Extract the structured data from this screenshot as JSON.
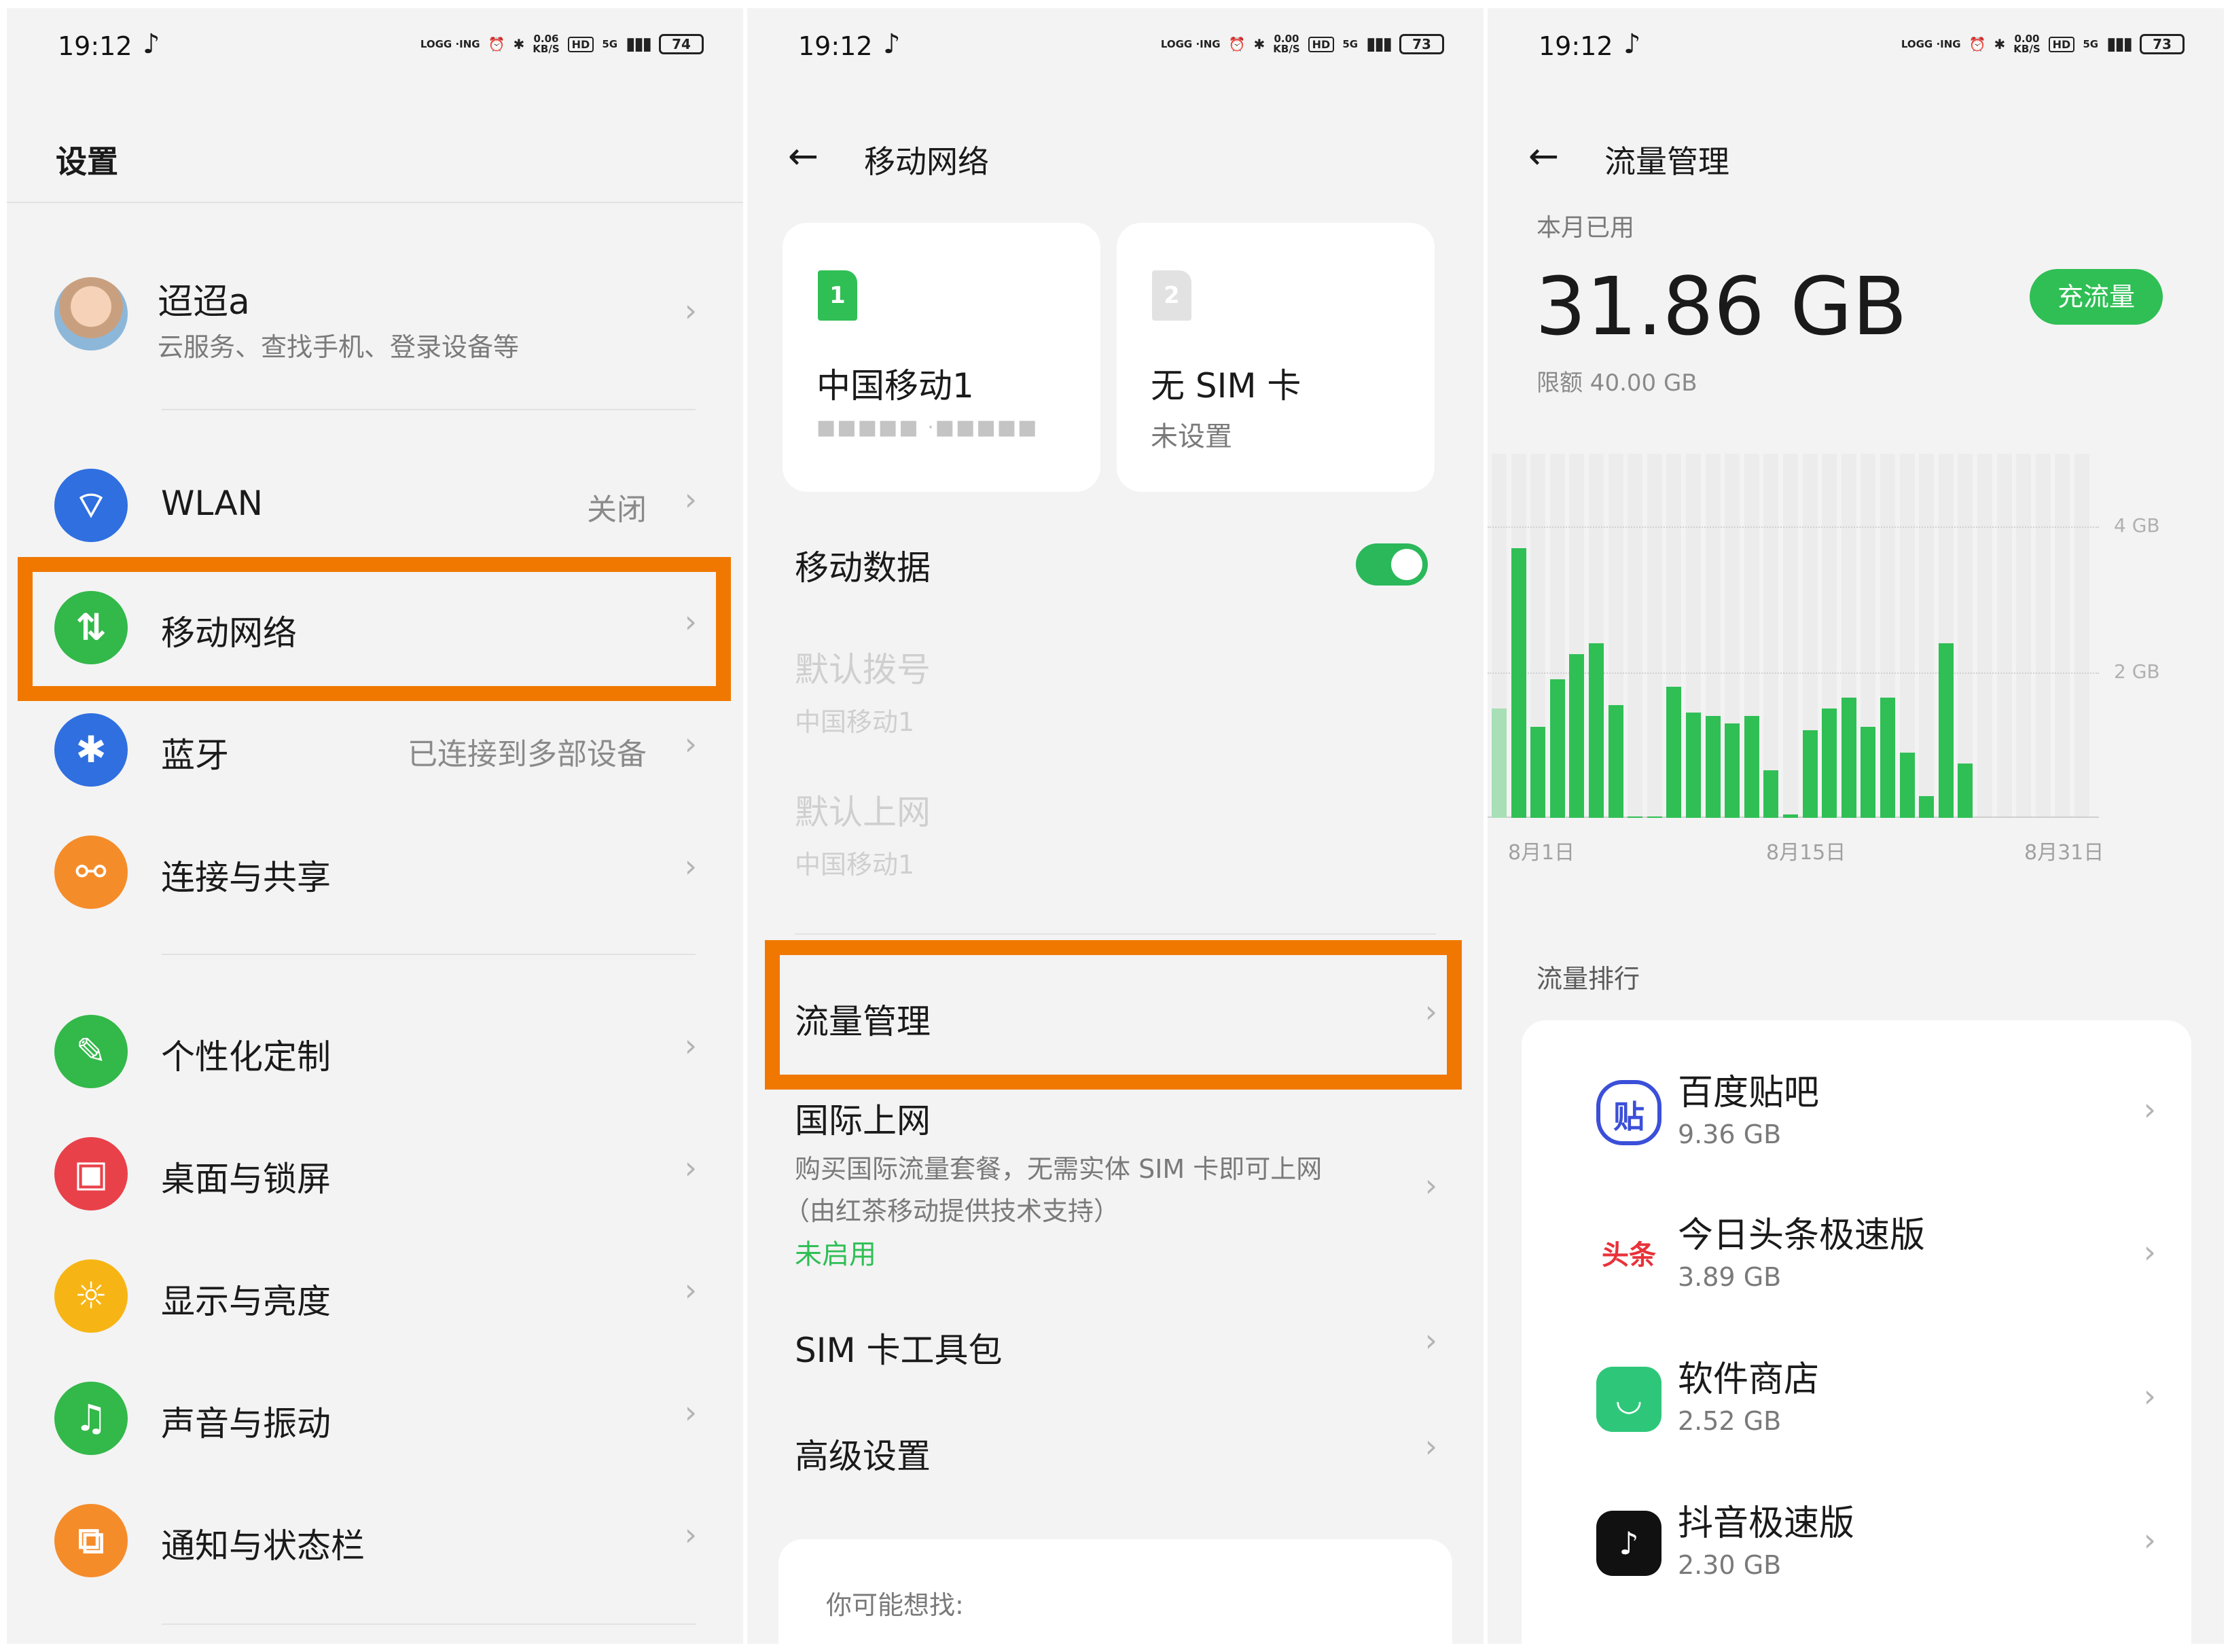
{
  "status": {
    "time": "19:12",
    "net": "LOGG ·ING",
    "speed1": {
      "value": "0.06",
      "unit": "KB/S"
    },
    "speed2": {
      "value": "0.00",
      "unit": "KB/S"
    },
    "hd": "HD",
    "signal": "5G",
    "battery1": "74",
    "battery2": "73",
    "battery3": "73"
  },
  "screen1": {
    "title": "设置",
    "account": {
      "name": "迢迢a",
      "sub": "云服务、查找手机、登录设备等"
    },
    "items": [
      {
        "label": "WLAN",
        "value": "关闭",
        "icon": "wifi-icon",
        "color": "#2f6fe0"
      },
      {
        "label": "移动网络",
        "value": "",
        "icon": "mobile-data-icon",
        "color": "#33b84a"
      },
      {
        "label": "蓝牙",
        "value": "已连接到多部设备",
        "icon": "bluetooth-icon",
        "color": "#2f6fe0"
      },
      {
        "label": "连接与共享",
        "value": "",
        "icon": "share-icon",
        "color": "#f58c2a"
      },
      {
        "label": "个性化定制",
        "value": "",
        "icon": "personalize-icon",
        "color": "#33b84a"
      },
      {
        "label": "桌面与锁屏",
        "value": "",
        "icon": "wallpaper-icon",
        "color": "#e9414a"
      },
      {
        "label": "显示与亮度",
        "value": "",
        "icon": "brightness-icon",
        "color": "#f7b515"
      },
      {
        "label": "声音与振动",
        "value": "",
        "icon": "bell-icon",
        "color": "#33b84a"
      },
      {
        "label": "通知与状态栏",
        "value": "",
        "icon": "notification-icon",
        "color": "#f58c2a"
      }
    ]
  },
  "screen2": {
    "title": "移动网络",
    "sim1": {
      "chip": "1",
      "name": "中国移动1",
      "number": "■■■■■ ·■■■■■"
    },
    "sim2": {
      "chip": "2",
      "name": "无 SIM 卡",
      "sub": "未设置"
    },
    "mobile_data": "移动数据",
    "default_dial": {
      "label": "默认拨号",
      "sub": "中国移动1"
    },
    "default_net": {
      "label": "默认上网",
      "sub": "中国移动1"
    },
    "traffic": "流量管理",
    "intl": {
      "label": "国际上网",
      "desc1": "购买国际流量套餐，无需实体 SIM 卡即可上网",
      "desc2": "（由红茶移动提供技术支持）",
      "status": "未启用"
    },
    "sim_toolkit": "SIM 卡工具包",
    "advanced": "高级设置",
    "suggest": "你可能想找:"
  },
  "screen3": {
    "title": "流量管理",
    "month_label": "本月已用",
    "used": "31.86 GB",
    "recharge": "充流量",
    "limit": "限额 40.00 GB",
    "rank_title": "流量排行",
    "apps": [
      {
        "name": "百度贴吧",
        "usage": "9.36 GB",
        "icon": "baidu-tieba-icon",
        "glyph": "贴",
        "color": "#3b4fd8"
      },
      {
        "name": "今日头条极速版",
        "usage": "3.89 GB",
        "icon": "toutiao-icon",
        "glyph": "头条",
        "color": "#e8323a"
      },
      {
        "name": "软件商店",
        "usage": "2.52 GB",
        "icon": "app-store-icon",
        "glyph": "◡",
        "color": "#2ec77a"
      },
      {
        "name": "抖音极速版",
        "usage": "2.30 GB",
        "icon": "douyin-icon",
        "glyph": "♪",
        "color": "#111111"
      }
    ]
  },
  "chart_data": {
    "type": "bar",
    "x_ticks": [
      "8月1日",
      "8月15日",
      "8月31日"
    ],
    "y_ticks": [
      "4 GB",
      "2 GB"
    ],
    "ylim": [
      0,
      5
    ],
    "values": [
      1.5,
      3.7,
      1.25,
      1.9,
      2.25,
      2.4,
      1.55,
      0,
      0,
      1.8,
      1.45,
      1.4,
      1.3,
      1.4,
      0.65,
      0.05,
      1.2,
      1.5,
      1.65,
      1.25,
      1.65,
      0.9,
      0.3,
      2.4,
      0.75
    ]
  }
}
